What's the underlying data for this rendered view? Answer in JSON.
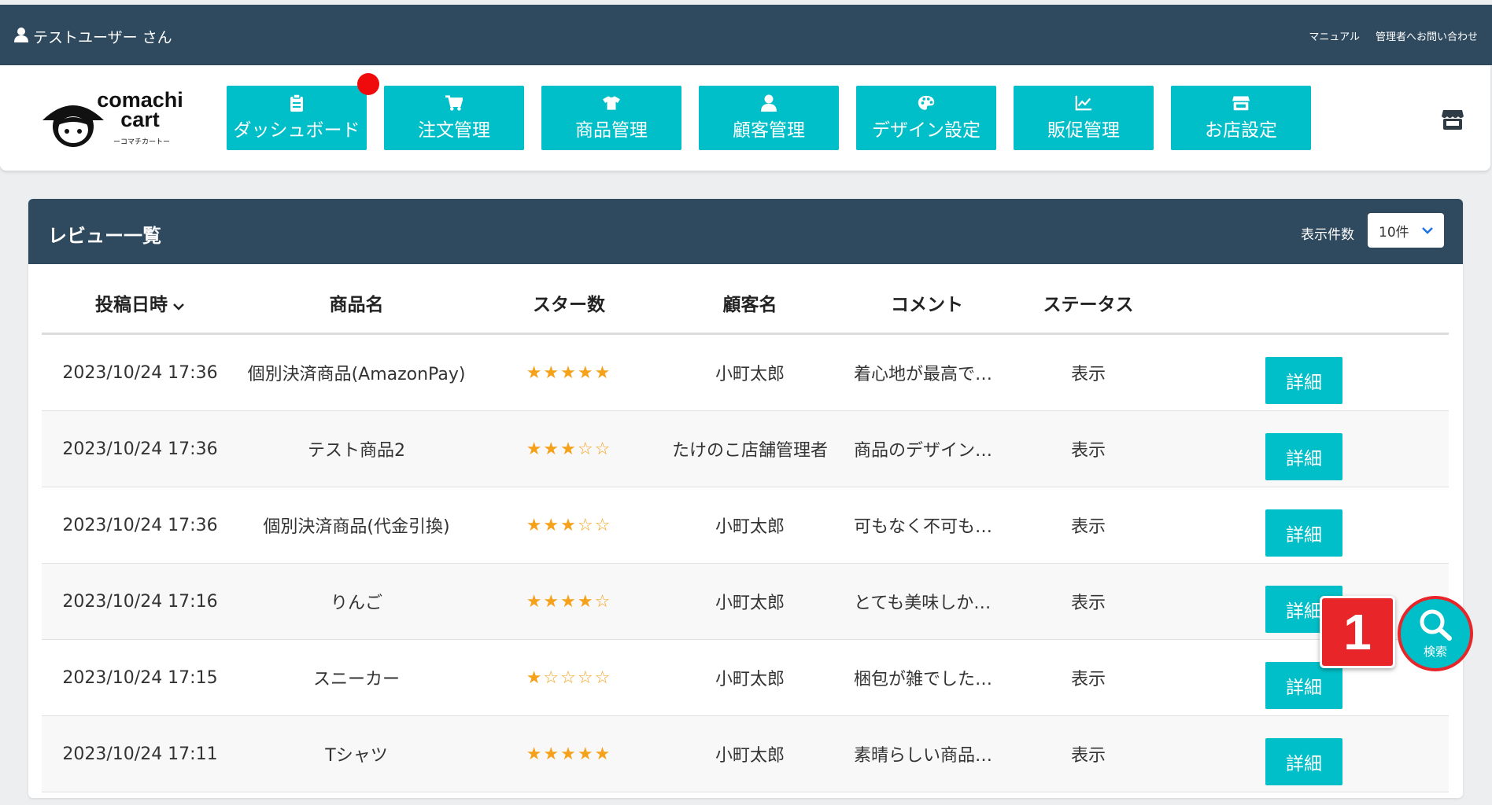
{
  "topbar": {
    "user_name": "テストユーザー さん",
    "links": [
      "マニュアル",
      "管理者へお問い合わせ"
    ]
  },
  "logo": {
    "line1": "comachi",
    "line2": "cart",
    "sub": "ーコマチカートー"
  },
  "nav": [
    {
      "label": "ダッシュボード",
      "icon": "clipboard-icon"
    },
    {
      "label": "注文管理",
      "icon": "cart-icon"
    },
    {
      "label": "商品管理",
      "icon": "tshirt-icon"
    },
    {
      "label": "顧客管理",
      "icon": "user-icon"
    },
    {
      "label": "デザイン設定",
      "icon": "palette-icon"
    },
    {
      "label": "販促管理",
      "icon": "chart-line-icon"
    },
    {
      "label": "お店設定",
      "icon": "store-icon"
    }
  ],
  "panel": {
    "title": "レビュー一覧",
    "count_label": "表示件数",
    "count_value": "10件"
  },
  "table": {
    "headers": [
      "投稿日時",
      "商品名",
      "スター数",
      "顧客名",
      "コメント",
      "ステータス"
    ],
    "rows": [
      {
        "date": "2023/10/24 17:36",
        "product": "個別決済商品(AmazonPay)",
        "stars": "★★★★★",
        "stars_value": 5,
        "customer": "小町太郎",
        "comment": "着心地が最高で…",
        "status": "表示",
        "action": "詳細"
      },
      {
        "date": "2023/10/24 17:36",
        "product": "テスト商品2",
        "stars": "★★★☆☆",
        "stars_value": 3,
        "customer": "たけのこ店舗管理者",
        "comment": "商品のデザイン…",
        "status": "表示",
        "action": "詳細"
      },
      {
        "date": "2023/10/24 17:36",
        "product": "個別決済商品(代金引換)",
        "stars": "★★★☆☆",
        "stars_value": 3,
        "customer": "小町太郎",
        "comment": "可もなく不可も…",
        "status": "表示",
        "action": "詳細"
      },
      {
        "date": "2023/10/24 17:16",
        "product": "りんご",
        "stars": "★★★★☆",
        "stars_value": 4,
        "customer": "小町太郎",
        "comment": "とても美味しか…",
        "status": "表示",
        "action": "詳細"
      },
      {
        "date": "2023/10/24 17:15",
        "product": "スニーカー",
        "stars": "★☆☆☆☆",
        "stars_value": 1,
        "customer": "小町太郎",
        "comment": "梱包が雑でした…",
        "status": "表示",
        "action": "詳細"
      },
      {
        "date": "2023/10/24 17:11",
        "product": "Tシャツ",
        "stars": "★★★★★",
        "stars_value": 5,
        "customer": "小町太郎",
        "comment": "素晴らしい商品…",
        "status": "表示",
        "action": "詳細"
      }
    ]
  },
  "marker": {
    "number": "1"
  },
  "search_fab": {
    "label": "検索"
  },
  "colors": {
    "header_bg": "#2f4a5e",
    "accent": "#00bfc8",
    "star": "#f5a11a",
    "marker": "#e8262a"
  }
}
